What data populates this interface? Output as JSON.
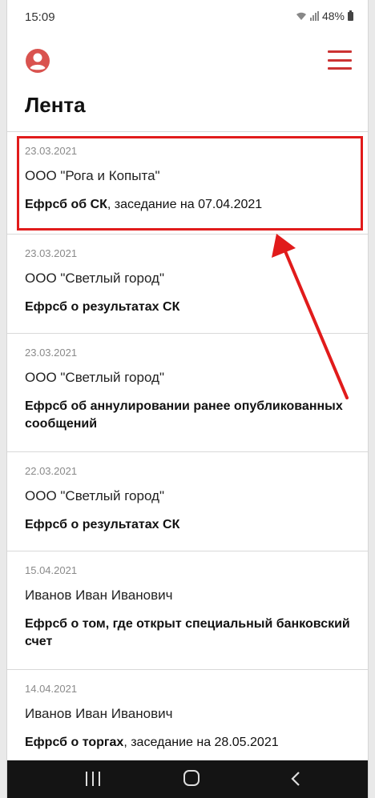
{
  "status_bar": {
    "time": "15:09",
    "battery": "48%"
  },
  "header": {
    "title": "Лента"
  },
  "feed": [
    {
      "date": "23.03.2021",
      "company": "ООО \"Рога и Копыта\"",
      "prefix": "Ефрсб",
      "topic": "об СК",
      "suffix": ", заседание на 07.04.2021"
    },
    {
      "date": "23.03.2021",
      "company": "ООО \"Светлый город\"",
      "prefix": "Ефрсб",
      "topic": "о результатах СК",
      "suffix": ""
    },
    {
      "date": "23.03.2021",
      "company": "ООО \"Светлый город\"",
      "prefix": "Ефрсб",
      "topic": "об аннулировании ранее опубликованных сообщений",
      "suffix": ""
    },
    {
      "date": "22.03.2021",
      "company": "ООО \"Светлый город\"",
      "prefix": "Ефрсб",
      "topic": "о результатах СК",
      "suffix": ""
    },
    {
      "date": "15.04.2021",
      "company": "Иванов Иван Иванович",
      "prefix": "Ефрсб",
      "topic": "о том, где открыт специальный банковский счет",
      "suffix": ""
    },
    {
      "date": "14.04.2021",
      "company": "Иванов Иван Иванович",
      "prefix": "Ефрсб",
      "topic": "о торгах",
      "suffix": ", заседание на 28.05.2021"
    }
  ],
  "colors": {
    "accent": "#e05555",
    "highlight": "#e11b1b",
    "navbar": "#141414"
  },
  "icons": {
    "user": "account-circle-icon",
    "menu": "hamburger-menu-icon"
  }
}
